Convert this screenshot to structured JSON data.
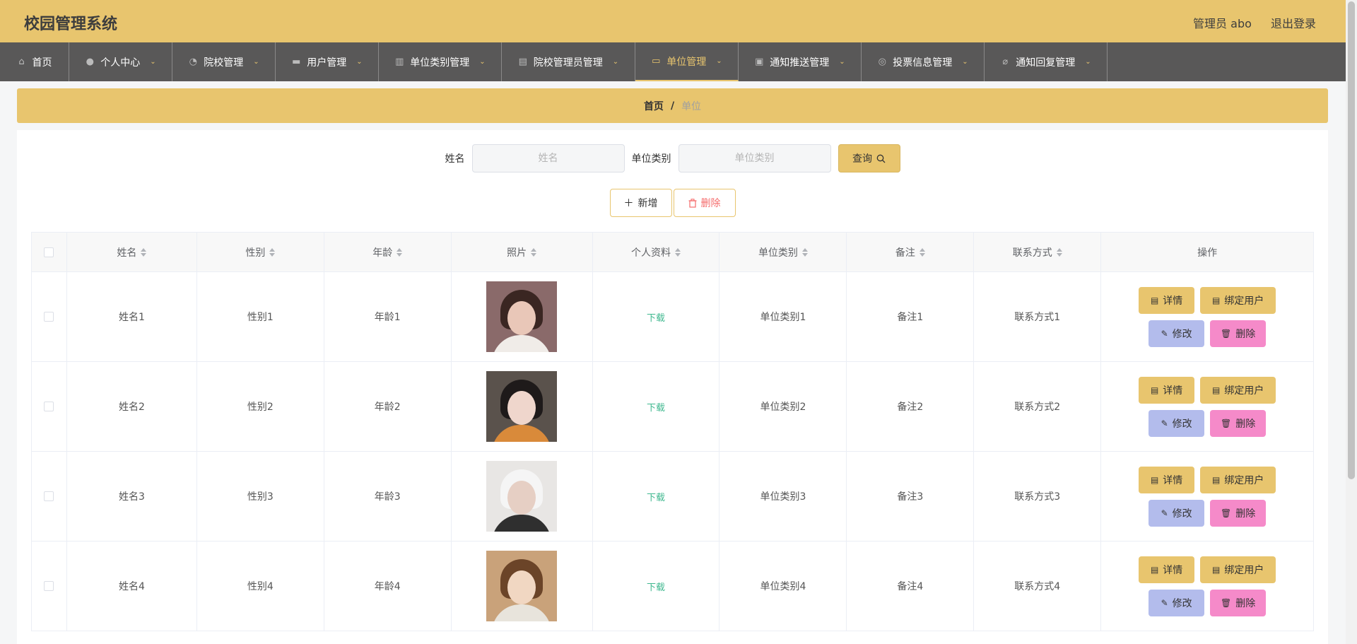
{
  "app": {
    "title": "校园管理系统",
    "user_label": "管理员 abo",
    "logout_label": "退出登录"
  },
  "nav": [
    {
      "label": "首页",
      "icon": "home-icon",
      "glyph": "⌂",
      "chevron": false,
      "active": false,
      "width": 98
    },
    {
      "label": "个人中心",
      "icon": "user-icon",
      "glyph": "●",
      "chevron": true,
      "active": false,
      "width": 146
    },
    {
      "label": "院校管理",
      "icon": "speedometer-icon",
      "glyph": "◔",
      "chevron": true,
      "active": false,
      "width": 146
    },
    {
      "label": "用户管理",
      "icon": "chat-icon",
      "glyph": "▬",
      "chevron": true,
      "active": false,
      "width": 146
    },
    {
      "label": "单位类别管理",
      "icon": "bar-chart-icon",
      "glyph": "▥",
      "chevron": true,
      "active": false,
      "width": 174
    },
    {
      "label": "院校管理员管理",
      "icon": "library-icon",
      "glyph": "▤",
      "chevron": true,
      "active": false,
      "width": 189
    },
    {
      "label": "单位管理",
      "icon": "monitor-icon",
      "glyph": "▭",
      "chevron": true,
      "active": true,
      "width": 146
    },
    {
      "label": "通知推送管理",
      "icon": "message-icon",
      "glyph": "▣",
      "chevron": true,
      "active": false,
      "width": 174
    },
    {
      "label": "投票信息管理",
      "icon": "compass-icon",
      "glyph": "◎",
      "chevron": true,
      "active": false,
      "width": 174
    },
    {
      "label": "通知回复管理",
      "icon": "bell-off-icon",
      "glyph": "⌀",
      "chevron": true,
      "active": false,
      "width": 174
    }
  ],
  "breadcrumb": {
    "home": "首页",
    "sep": "/",
    "current": "单位"
  },
  "search": {
    "name_label": "姓名",
    "name_placeholder": "姓名",
    "category_label": "单位类别",
    "category_placeholder": "单位类别",
    "button_label": "查询"
  },
  "actions": {
    "add_label": "新增",
    "delete_label": "删除"
  },
  "table": {
    "headers": [
      "姓名",
      "性别",
      "年龄",
      "照片",
      "个人资料",
      "单位类别",
      "备注",
      "联系方式",
      "操作"
    ],
    "download_label": "下载",
    "op_labels": {
      "detail": "详情",
      "bind": "绑定用户",
      "edit": "修改",
      "delete": "删除"
    },
    "rows": [
      {
        "name": "姓名1",
        "gender": "性别1",
        "age": "年龄1",
        "category": "单位类别1",
        "note": "备注1",
        "contact": "联系方式1",
        "photo": {
          "bg": "#8a6a6a",
          "hair": "#3a2622",
          "face": "#e9c7b8",
          "body": "#f0ece8"
        }
      },
      {
        "name": "姓名2",
        "gender": "性别2",
        "age": "年龄2",
        "category": "单位类别2",
        "note": "备注2",
        "contact": "联系方式2",
        "photo": {
          "bg": "#5a524c",
          "hair": "#1e1a1a",
          "face": "#efd6cc",
          "body": "#d98a3a"
        }
      },
      {
        "name": "姓名3",
        "gender": "性别3",
        "age": "年龄3",
        "category": "单位类别3",
        "note": "备注3",
        "contact": "联系方式3",
        "photo": {
          "bg": "#e8e6e4",
          "hair": "#f5f5f5",
          "face": "#e6cfc4",
          "body": "#2f2f2f"
        }
      },
      {
        "name": "姓名4",
        "gender": "性别4",
        "age": "年龄4",
        "category": "单位类别4",
        "note": "备注4",
        "contact": "联系方式4",
        "photo": {
          "bg": "#c9a27a",
          "hair": "#6b4428",
          "face": "#f1d7c2",
          "body": "#e8e4dc"
        }
      }
    ]
  }
}
